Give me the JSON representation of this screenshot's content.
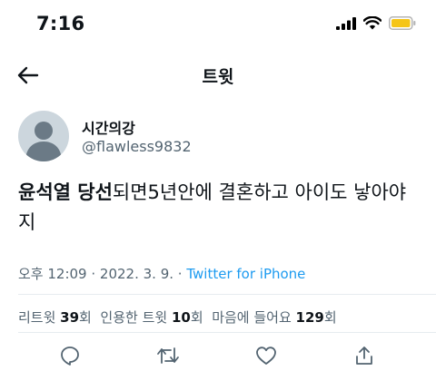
{
  "status_bar": {
    "time": "7:16"
  },
  "nav": {
    "title": "트윗"
  },
  "author": {
    "name": "시간의강",
    "handle": "@flawless9832"
  },
  "tweet": {
    "text_bold": "윤석열 당선",
    "text_rest": "되면5년안에 결혼하고 아이도 낳아야지"
  },
  "meta": {
    "time": "오후 12:09",
    "sep1": " · ",
    "date": "2022. 3. 9.",
    "sep2": " · ",
    "source": "Twitter for iPhone"
  },
  "stats": {
    "retweets_label": "리트윗 ",
    "retweets_count": "39",
    "retweets_unit": "회",
    "quotes_label": "인용한 트윗 ",
    "quotes_count": "10",
    "quotes_unit": "회",
    "likes_label": "마음에 들어요 ",
    "likes_count": "129",
    "likes_unit": "회"
  },
  "colors": {
    "accent": "#1d9bf0",
    "battery": "#f5c518",
    "secondary_text": "#536471"
  },
  "icons": {
    "signal": "cellular-signal-icon",
    "wifi": "wifi-icon",
    "battery": "battery-icon",
    "back": "back-arrow-icon",
    "reply": "reply-icon",
    "retweet": "retweet-icon",
    "like": "heart-icon",
    "share": "share-icon"
  }
}
